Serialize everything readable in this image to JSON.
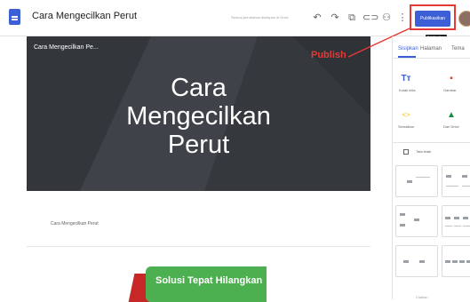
{
  "header": {
    "doc_title": "Cara Mengecilkan Perut",
    "save_status": "Semua perubahan disimpan di Drive",
    "publish_label": "Publikasikan",
    "publish_tooltip": "Publikasikan",
    "icons": [
      "undo-icon",
      "redo-icon",
      "preview-icon",
      "link-icon",
      "share-person-icon",
      "more-vert-icon"
    ]
  },
  "annotation": {
    "label": "Publish",
    "color": "#e53935"
  },
  "page": {
    "hero_small_title": "Cara Mengecilkan Pe...",
    "hero_title": "Cara\nMengecilkan\nPerut",
    "subtitle": "Cara Mengecilkan Perut",
    "banner_text": "Solusi Tepat Hilangkan"
  },
  "sidebar": {
    "tabs": [
      "Sisipkan",
      "Halaman",
      "Tema"
    ],
    "active_tab": "Sisipkan",
    "tools": [
      {
        "icon": "text-box-icon",
        "label": "Kotak teks",
        "color": "#3c5fd6"
      },
      {
        "icon": "image-icon",
        "label": "Gambar",
        "color": "#e53935"
      },
      {
        "icon": "embed-icon",
        "label": "Sematkan",
        "color": "#fbbc04"
      },
      {
        "icon": "drive-icon",
        "label": "Dari Drive",
        "color": "#1e8e3e"
      }
    ],
    "layouts_label": "Tata letak",
    "bottom_label": "Ciutkan"
  },
  "colors": {
    "accent": "#3c5fd6",
    "hero_background": "#3b3f45",
    "banner_green": "#4caf50",
    "banner_red": "#c62828"
  }
}
